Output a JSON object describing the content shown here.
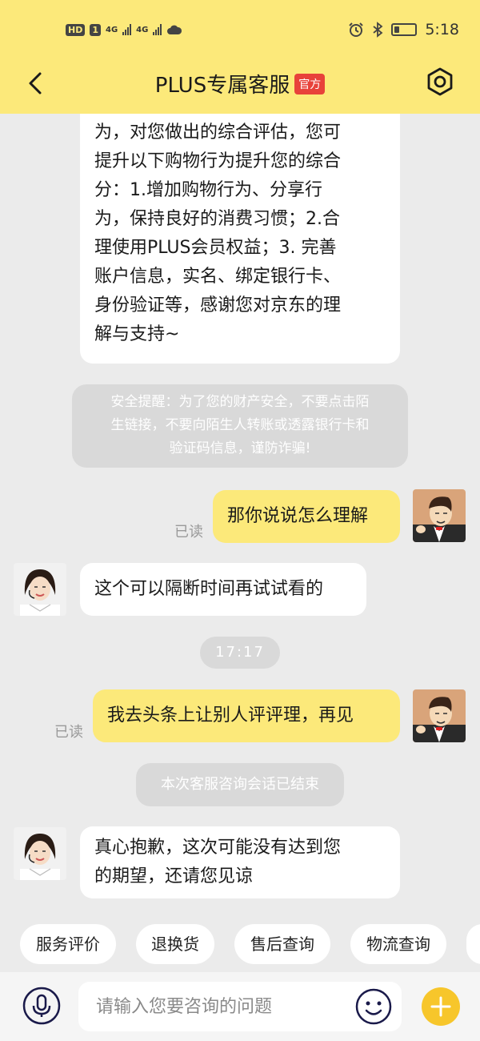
{
  "status_bar": {
    "network_hd": "HD",
    "sim1": "1",
    "net1": "4G",
    "net2": "4G",
    "time": "5:18",
    "battery_level": 0.25
  },
  "header": {
    "title": "PLUS专属客服",
    "badge": "官方"
  },
  "messages": {
    "m1_lines": [
      "为，对您做出的综合评估，您可",
      "提升以下购物行为提升您的综合",
      "分：1.增加购物行为、分享行",
      "为，保持良好的消费习惯；2.合",
      "理使用PLUS会员权益；3. 完善",
      "账户信息，实名、绑定银行卡、",
      "身份验证等，感谢您对京东的理",
      "解与支持~"
    ],
    "safety_lines": [
      "安全提醒：为了您的财产安全，不要点击陌",
      "生链接，不要向陌生人转账或透露银行卡和",
      "验证码信息，谨防诈骗!"
    ],
    "out1_text": "那你说说怎么理解",
    "out1_status": "已读",
    "in2_text": "这个可以隔断时间再试试看的",
    "time_divider": "17:17",
    "out2_text": "我去头条上让别人评评理，再见",
    "out2_status": "已读",
    "session_ended": "本次客服咨询会话已结束",
    "in3_lines": [
      "真心抱歉，这次可能没有达到您",
      "的期望，还请您见谅"
    ]
  },
  "quick_actions": [
    "服务评价",
    "退换货",
    "售后查询",
    "物流查询"
  ],
  "input": {
    "placeholder": "请输入您要咨询的问题"
  },
  "colors": {
    "brand_yellow": "#fce97a",
    "official_red": "#e8423a",
    "plus_button": "#f7c62b"
  }
}
